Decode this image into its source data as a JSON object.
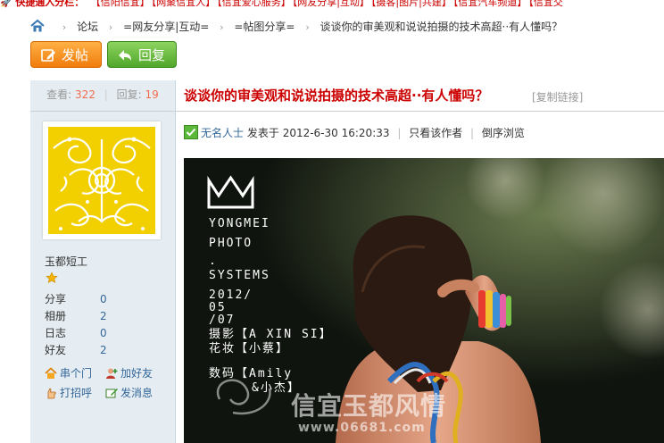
{
  "topbar": {
    "prefix": "🚀",
    "hot_label": "快捷通入分栏：",
    "links": [
      "【信阳信宜】",
      "【网聚信宜人】",
      "【信宜爱心服务】",
      "【网友分享|互动】",
      "【摄客|图片|共建】",
      "【信宜汽车频道】",
      "【信宜交"
    ]
  },
  "breadcrumb": {
    "separator": "›",
    "items": [
      "论坛",
      "=网友分享|互动=",
      "=帖图分享=",
      "谈谈你的审美观和说说拍摄的技术高超··有人懂吗？"
    ]
  },
  "actions": {
    "post_label": "发帖",
    "reply_label": "回复"
  },
  "stats": {
    "views_label": "查看:",
    "views": "322",
    "replies_label": "回复:",
    "replies": "19"
  },
  "user": {
    "name": "玉都短工",
    "profile": [
      {
        "k": "分享",
        "v": "0"
      },
      {
        "k": "相册",
        "v": "2"
      },
      {
        "k": "日志",
        "v": "0"
      },
      {
        "k": "好友",
        "v": "2"
      }
    ],
    "links": {
      "visit": "串个门",
      "add_friend": "加好友",
      "greet": "打招呼",
      "message": "发消息"
    }
  },
  "post": {
    "title": "谈谈你的审美观和说说拍摄的技术高超··有人懂吗？",
    "copy_link": "[复制链接]",
    "author": "无名人士",
    "posted_prefix": "发表于",
    "time": "2012-6-30 16:20:33",
    "only_author": "只看该作者",
    "reverse": "倒序浏览"
  },
  "photo": {
    "brand_lines": [
      "YONGMEI",
      "PHOTO",
      ".",
      "SYSTEMS"
    ],
    "date_lines": [
      "2012/",
      "05",
      "/07"
    ],
    "credit_photo": "摄影【A XIN SI】",
    "credit_makeup": "花妆【小蔡】",
    "credit_digital": "数码【Amily",
    "credit_digital2": "&小杰】",
    "watermark": "信宜玉都风情",
    "watermark_url": "www.06681.com"
  },
  "colors": {
    "title": "#cc0000",
    "link": "#336699",
    "side_bg": "#e5edf2",
    "count": "#f26c4f"
  }
}
